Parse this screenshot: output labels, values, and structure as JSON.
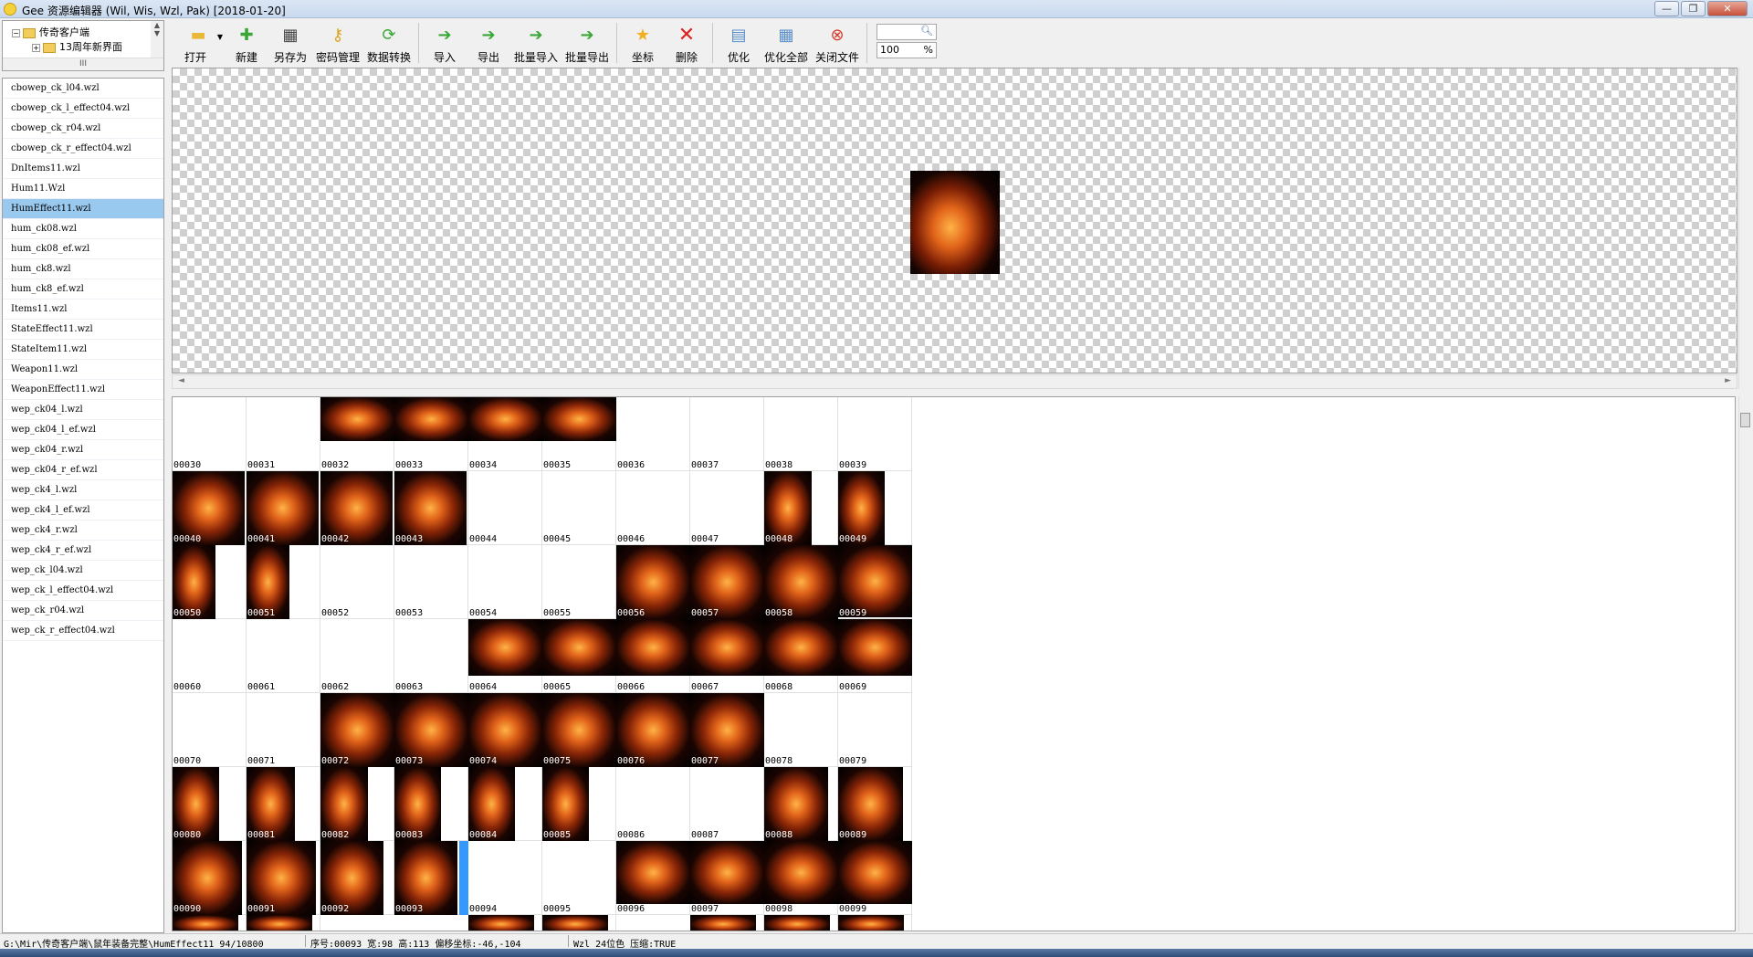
{
  "window": {
    "title": "Gee 资源编辑器 (Wil, Wis, Wzl, Pak) [2018-01-20]",
    "buttons": [
      "—",
      "❐",
      "✕"
    ]
  },
  "tree": {
    "root": "传奇客户端",
    "child": "13周年新界面",
    "scroll_glyph": "III"
  },
  "toolbar": {
    "open": "打开",
    "new": "新建",
    "save_as": "另存为",
    "password": "密码管理",
    "convert": "数据转换",
    "import": "导入",
    "export": "导出",
    "batch_import": "批量导入",
    "batch_export": "批量导出",
    "coords": "坐标",
    "delete": "删除",
    "optimize": "优化",
    "optimize_all": "优化全部",
    "close_file": "关闭文件",
    "zoom_value": "100",
    "zoom_unit": "%"
  },
  "files": [
    "cbowep_ck_l04.wzl",
    "cbowep_ck_l_effect04.wzl",
    "cbowep_ck_r04.wzl",
    "cbowep_ck_r_effect04.wzl",
    "DnItems11.wzl",
    "Hum11.Wzl",
    "HumEffect11.wzl",
    "hum_ck08.wzl",
    "hum_ck08_ef.wzl",
    "hum_ck8.wzl",
    "hum_ck8_ef.wzl",
    "Items11.wzl",
    "StateEffect11.wzl",
    "StateItem11.wzl",
    "Weapon11.wzl",
    "WeaponEffect11.wzl",
    "wep_ck04_l.wzl",
    "wep_ck04_l_ef.wzl",
    "wep_ck04_r.wzl",
    "wep_ck04_r_ef.wzl",
    "wep_ck4_l.wzl",
    "wep_ck4_l_ef.wzl",
    "wep_ck4_r.wzl",
    "wep_ck4_r_ef.wzl",
    "wep_ck_l04.wzl",
    "wep_ck_l_effect04.wzl",
    "wep_ck_r04.wzl",
    "wep_ck_r_effect04.wzl"
  ],
  "selected_file": "HumEffect11.wzl",
  "grid": {
    "selected_index": "00093",
    "rows": [
      [
        "00030",
        "00031",
        "00032",
        "00033",
        "00034",
        "00035",
        "00036",
        "00037",
        "00038",
        "00039"
      ],
      [
        "00040",
        "00041",
        "00042",
        "00043",
        "00044",
        "00045",
        "00046",
        "00047",
        "00048",
        "00049"
      ],
      [
        "00050",
        "00051",
        "00052",
        "00053",
        "00054",
        "00055",
        "00056",
        "00057",
        "00058",
        "00059"
      ],
      [
        "00060",
        "00061",
        "00062",
        "00063",
        "00064",
        "00065",
        "00066",
        "00067",
        "00068",
        "00069"
      ],
      [
        "00070",
        "00071",
        "00072",
        "00073",
        "00074",
        "00075",
        "00076",
        "00077",
        "00078",
        "00079"
      ],
      [
        "00080",
        "00081",
        "00082",
        "00083",
        "00084",
        "00085",
        "00086",
        "00087",
        "00088",
        "00089"
      ],
      [
        "00090",
        "00091",
        "00092",
        "00093",
        "00094",
        "00095",
        "00096",
        "00097",
        "00098",
        "00099"
      ]
    ]
  },
  "status": {
    "path": "G:\\Mir\\传奇客户端\\鼠年装备完整\\HumEffect11 94/10800",
    "info": "序号:00093 宽:98 高:113 偏移坐标:-46,-104",
    "format": "Wzl 24位色 压缩:TRUE"
  }
}
